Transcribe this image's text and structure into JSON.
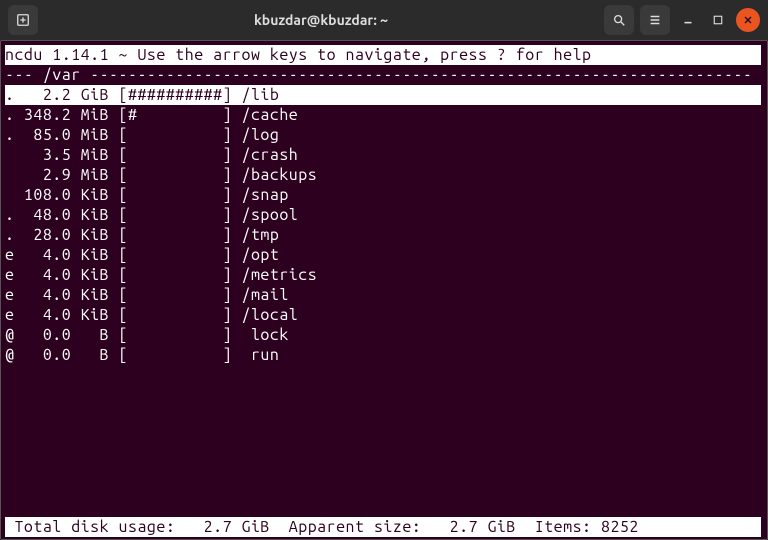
{
  "window": {
    "title": "kbuzdar@kbuzdar: ~"
  },
  "ncdu": {
    "header": "ncdu 1.14.1 ~ Use the arrow keys to navigate, press ? for help",
    "path_line": "--- /var ----------------------------------------------------------------------",
    "footer": " Total disk usage:   2.7 GiB  Apparent size:   2.7 GiB  Items: 8252",
    "rows": [
      {
        "flag": ".",
        "size": "   2.2 GiB",
        "bar": "[##########]",
        "name": "/lib",
        "selected": true
      },
      {
        "flag": ".",
        "size": " 348.2 MiB",
        "bar": "[#         ]",
        "name": "/cache",
        "selected": false
      },
      {
        "flag": ".",
        "size": "  85.0 MiB",
        "bar": "[          ]",
        "name": "/log",
        "selected": false
      },
      {
        "flag": " ",
        "size": "   3.5 MiB",
        "bar": "[          ]",
        "name": "/crash",
        "selected": false
      },
      {
        "flag": " ",
        "size": "   2.9 MiB",
        "bar": "[          ]",
        "name": "/backups",
        "selected": false
      },
      {
        "flag": " ",
        "size": " 108.0 KiB",
        "bar": "[          ]",
        "name": "/snap",
        "selected": false
      },
      {
        "flag": ".",
        "size": "  48.0 KiB",
        "bar": "[          ]",
        "name": "/spool",
        "selected": false
      },
      {
        "flag": ".",
        "size": "  28.0 KiB",
        "bar": "[          ]",
        "name": "/tmp",
        "selected": false
      },
      {
        "flag": "e",
        "size": "   4.0 KiB",
        "bar": "[          ]",
        "name": "/opt",
        "selected": false
      },
      {
        "flag": "e",
        "size": "   4.0 KiB",
        "bar": "[          ]",
        "name": "/metrics",
        "selected": false
      },
      {
        "flag": "e",
        "size": "   4.0 KiB",
        "bar": "[          ]",
        "name": "/mail",
        "selected": false
      },
      {
        "flag": "e",
        "size": "   4.0 KiB",
        "bar": "[          ]",
        "name": "/local",
        "selected": false
      },
      {
        "flag": "@",
        "size": "   0.0   B",
        "bar": "[          ]",
        "name": " lock",
        "selected": false
      },
      {
        "flag": "@",
        "size": "   0.0   B",
        "bar": "[          ]",
        "name": " run",
        "selected": false
      }
    ]
  }
}
